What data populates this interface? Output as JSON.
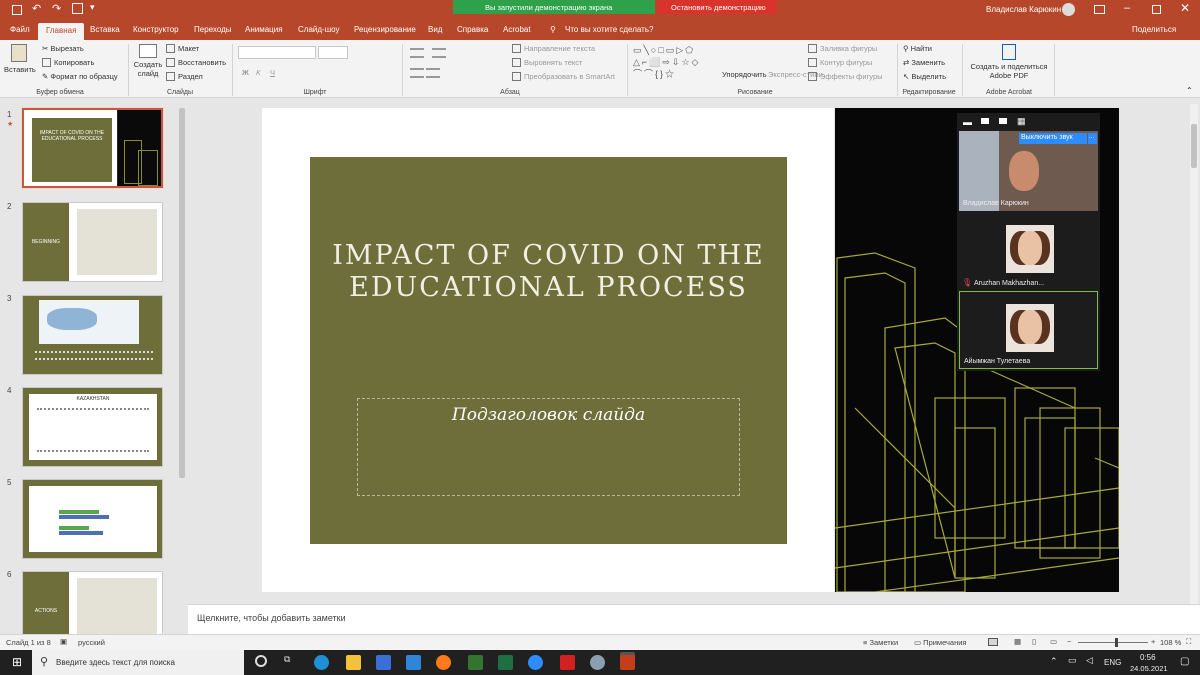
{
  "window": {
    "user": "Владислав Карюкин",
    "share_notice": "Вы запустили демонстрацию экрана",
    "stop_share": "Остановить демонстрацию",
    "share_btn": "Поделиться"
  },
  "tabs": [
    "Файл",
    "Главная",
    "Вставка",
    "Конструктор",
    "Переходы",
    "Анимация",
    "Слайд-шоу",
    "Рецензирование",
    "Вид",
    "Справка",
    "Acrobat"
  ],
  "tell_me": "Что вы хотите сделать?",
  "ribbon": {
    "paste": "Вставить",
    "cut": "Вырезать",
    "copy": "Копировать",
    "format_painter": "Формат по образцу",
    "clipboard": "Буфер обмена",
    "new_slide": "Создать слайд",
    "layout": "Макет",
    "reset": "Восстановить",
    "section": "Раздел",
    "slides": "Слайды",
    "font": "Шрифт",
    "paragraph": "Абзац",
    "text_direction": "Направление текста",
    "align_text": "Выровнять текст",
    "smartart": "Преобразовать в SmartArt",
    "arrange": "Упорядочить",
    "quick_styles": "Экспресс-стили",
    "fill": "Заливка фигуры",
    "outline": "Контур фигуры",
    "effects": "Эффекты фигуры",
    "drawing": "Рисование",
    "find": "Найти",
    "replace": "Заменить",
    "select": "Выделить",
    "editing": "Редактирование",
    "adobe_create": "Создать и поделиться Adobe PDF",
    "adobe": "Adobe Acrobat",
    "font_bold": "Ж",
    "font_italic": "К",
    "font_underline": "Ч"
  },
  "slide_numbers": [
    "1",
    "2",
    "3",
    "4",
    "5",
    "6"
  ],
  "thumbs": {
    "t1": "IMPACT OF COVID ON THE EDUCATIONAL PROCESS",
    "t2": "BEGINNING",
    "t4": "KAZAKHSTAN",
    "t6": "ACTIONS"
  },
  "slide": {
    "title": "IMPACT OF COVID ON THE EDUCATIONAL PROCESS",
    "subtitle": "Подзаголовок слайда"
  },
  "zoom": {
    "mute": "Выключить звук",
    "p1": "Владислав Карюкин",
    "p2": "Aruzhan Makhazhan...",
    "p3": "Айымжан Тулетаева"
  },
  "notes": "Щелкните, чтобы добавить заметки",
  "status": {
    "slide": "Слайд 1 из 8",
    "lang": "русский",
    "notes": "Заметки",
    "comments": "Примечания",
    "zoom": "108 %"
  },
  "taskbar": {
    "search": "Введите здесь текст для поиска",
    "lang": "ENG",
    "time": "0:56",
    "date": "24.05.2021"
  }
}
